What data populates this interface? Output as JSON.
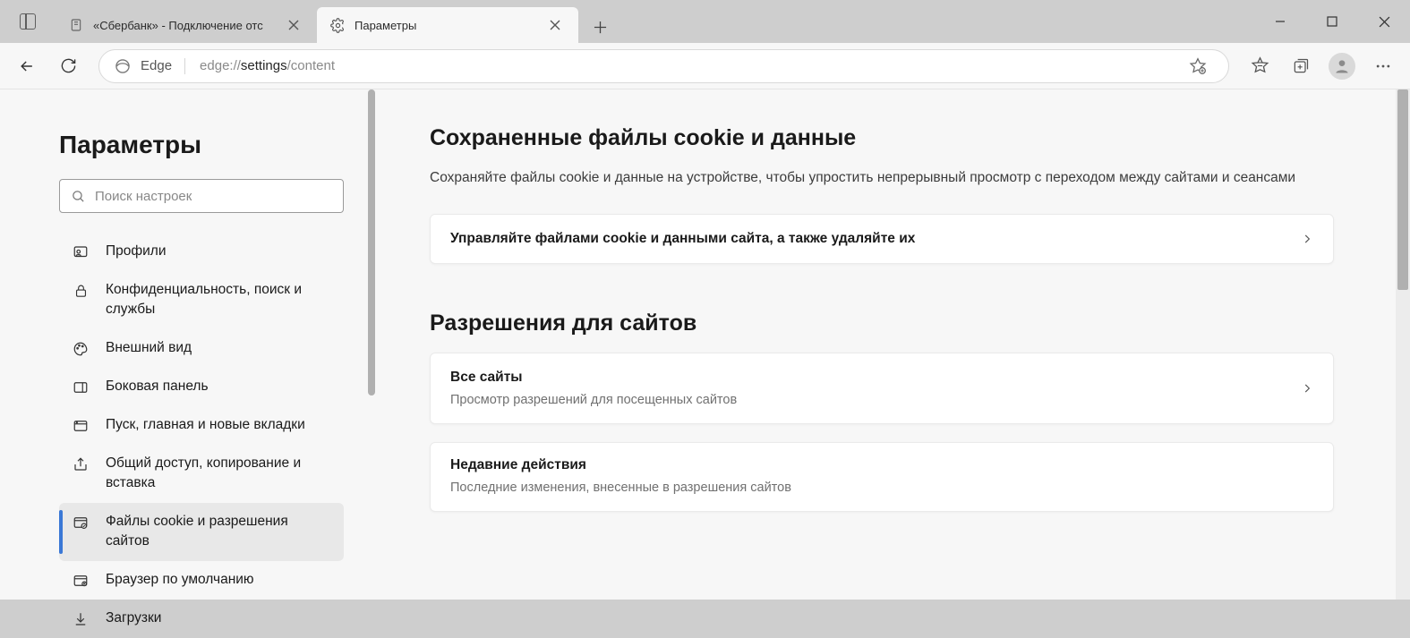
{
  "tabs": [
    {
      "title": "«Сбербанк» - Подключение отс",
      "active": false
    },
    {
      "title": "Параметры",
      "active": true
    }
  ],
  "address": {
    "label": "Edge",
    "prefix": "edge://",
    "strong": "settings",
    "suffix": "/content"
  },
  "sidebar": {
    "title": "Параметры",
    "search_placeholder": "Поиск настроек",
    "items": [
      {
        "label": "Профили"
      },
      {
        "label": "Конфиденциальность, поиск и службы"
      },
      {
        "label": "Внешний вид"
      },
      {
        "label": "Боковая панель"
      },
      {
        "label": "Пуск, главная и новые вкладки"
      },
      {
        "label": "Общий доступ, копирование и вставка"
      },
      {
        "label": "Файлы cookie и разрешения сайтов"
      },
      {
        "label": "Браузер по умолчанию"
      },
      {
        "label": "Загрузки"
      }
    ],
    "active_index": 6
  },
  "main": {
    "s1_title": "Сохраненные файлы cookie и данные",
    "s1_desc": "Сохраняйте файлы cookie и данные на устройстве, чтобы упростить непрерывный просмотр с переходом между сайтами и сеансами",
    "s1_card": "Управляйте файлами cookie и данными сайта, а также удаляйте их",
    "s2_title": "Разрешения для сайтов",
    "s2_card1_title": "Все сайты",
    "s2_card1_sub": "Просмотр разрешений для посещенных сайтов",
    "s2_card2_title": "Недавние действия",
    "s2_card2_sub": "Последние изменения, внесенные в разрешения сайтов"
  }
}
